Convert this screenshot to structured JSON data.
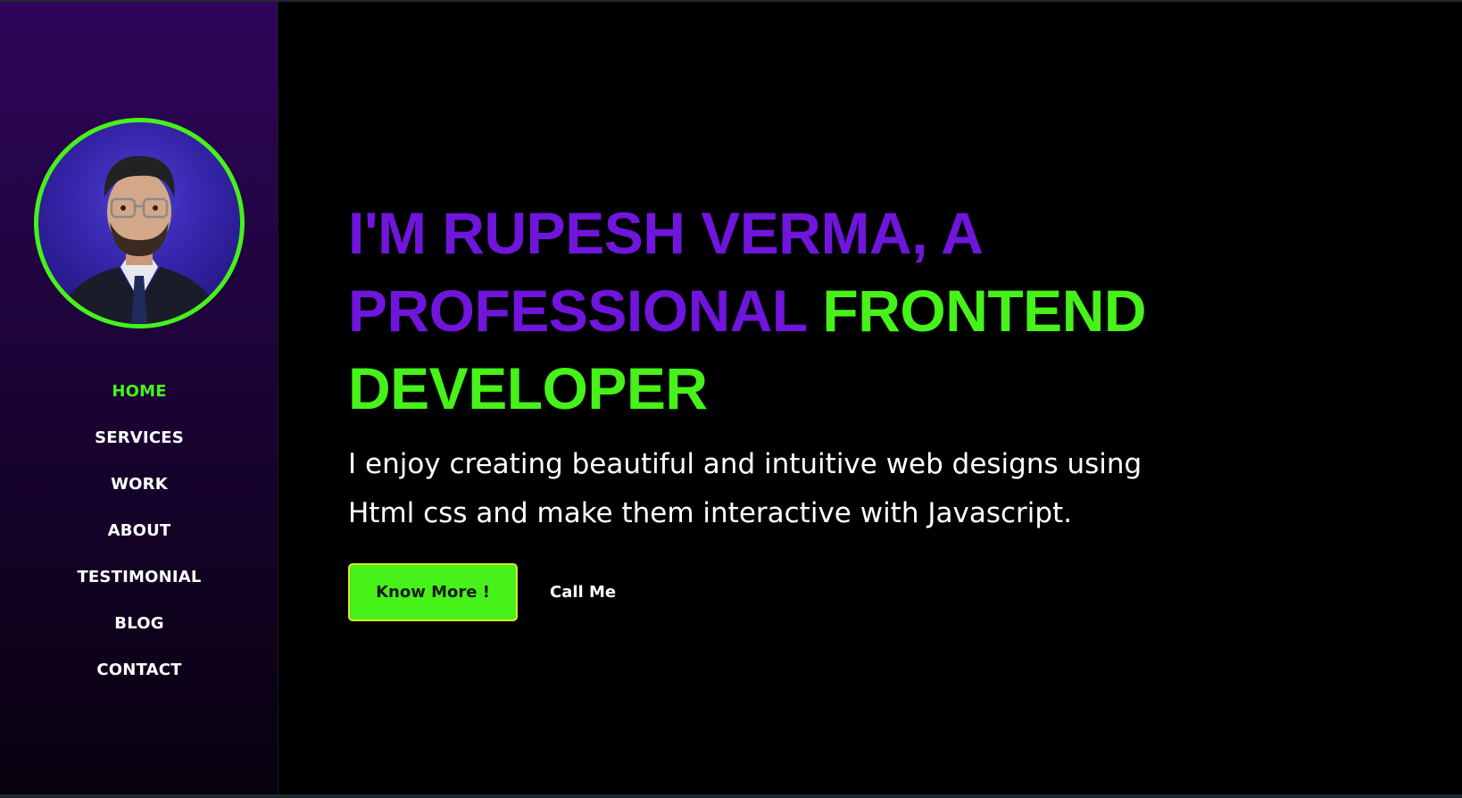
{
  "sidebar": {
    "nav": [
      {
        "label": "HOME",
        "active": true
      },
      {
        "label": "SERVICES",
        "active": false
      },
      {
        "label": "WORK",
        "active": false
      },
      {
        "label": "ABOUT",
        "active": false
      },
      {
        "label": "TESTIMONIAL",
        "active": false
      },
      {
        "label": "BLOG",
        "active": false
      },
      {
        "label": "CONTACT",
        "active": false
      }
    ]
  },
  "hero": {
    "headline_part1": "I'M RUPESH VERMA, A PROFESSIONAL ",
    "headline_part2": "FRONTEND DEVELOPER",
    "subtitle": "I enjoy creating beautiful and intuitive web designs using Html css and make them interactive with Javascript.",
    "primary_button": "Know More !",
    "secondary_button": "Call Me"
  },
  "colors": {
    "accent_green": "#46f21a",
    "accent_purple": "#7015dc",
    "background": "#000000"
  },
  "icons": {
    "avatar": "profile-photo"
  }
}
